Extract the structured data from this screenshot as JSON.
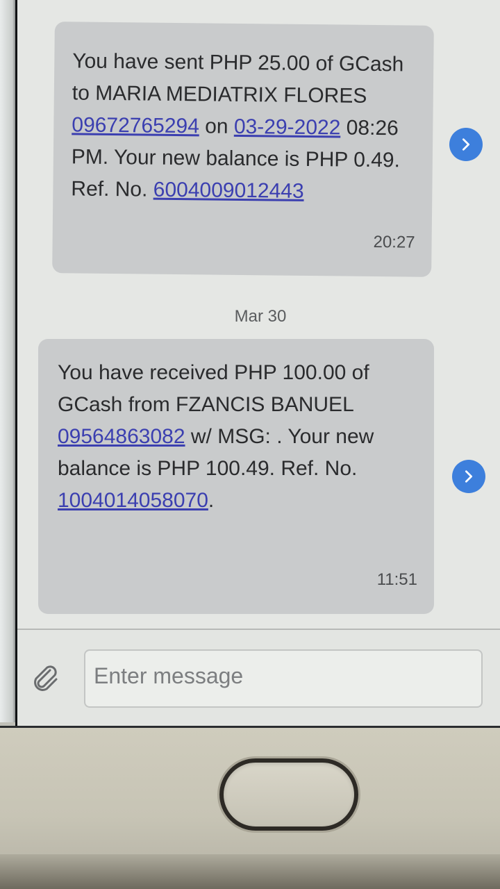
{
  "messages": [
    {
      "pre": "You have sent PHP 25.00 of GCash to MARIA MEDIATRIX FLORES ",
      "phone": "09672765294",
      "mid": " on ",
      "date": "03-29-2022",
      "post": " 08:26 PM. Your new balance is PHP 0.49. Ref. No. ",
      "ref": "6004009012443",
      "end": "",
      "time": "20:27"
    },
    {
      "pre": "You have received PHP 100.00 of GCash from FZANCIS BANUEL ",
      "phone": "09564863082",
      "post": " w/ MSG: . Your new balance is PHP 100.49. Ref. No. ",
      "ref": "1004014058070",
      "end": ".",
      "time": "11:51"
    }
  ],
  "date_separator": "Mar 30",
  "compose": {
    "placeholder": "Enter message"
  },
  "icons": {
    "forward": "chevron-right-icon",
    "attach": "paperclip-icon"
  },
  "colors": {
    "accent": "#3d7fdc",
    "link": "#3b3fb0",
    "bubble": "#c9cbcc"
  }
}
